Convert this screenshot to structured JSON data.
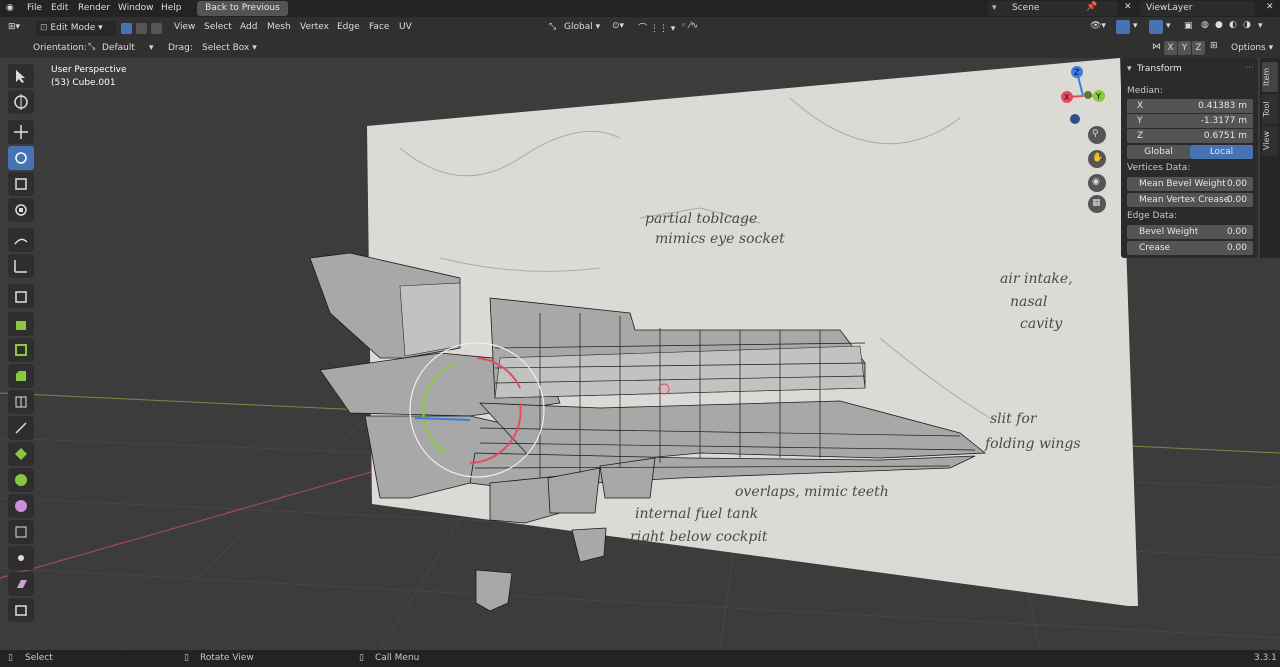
{
  "topbar": {
    "menus": [
      "File",
      "Edit",
      "Render",
      "Window",
      "Help"
    ],
    "back_button": "Back to Previous",
    "scene": "Scene",
    "view_layer": "ViewLayer"
  },
  "header": {
    "mode": "Edit Mode",
    "menus": [
      "View",
      "Select",
      "Add",
      "Mesh",
      "Vertex",
      "Edge",
      "Face",
      "UV"
    ],
    "transform_orientation": "Global"
  },
  "subheader": {
    "orientation_label": "Orientation:",
    "orientation_value": "Default",
    "drag_label": "Drag:",
    "drag_value": "Select Box",
    "axes": [
      "X",
      "Y",
      "Z"
    ],
    "options": "Options"
  },
  "viewport": {
    "perspective": "User Perspective",
    "object": "(53) Cube.001"
  },
  "gizmo": {
    "x": "X",
    "y": "Y",
    "z": "Z"
  },
  "npanel": {
    "title": "Transform",
    "median_label": "Median:",
    "median": [
      {
        "axis": "X",
        "value": "0.41383 m"
      },
      {
        "axis": "Y",
        "value": "-1.3177 m"
      },
      {
        "axis": "Z",
        "value": "0.6751 m"
      }
    ],
    "space_global": "Global",
    "space_local": "Local",
    "vertices_label": "Vertices Data:",
    "mean_bevel_weight_label": "Mean Bevel Weight",
    "mean_bevel_weight": "0.00",
    "mean_vertex_crease_label": "Mean Vertex Crease",
    "mean_vertex_crease": "0.00",
    "edge_label": "Edge Data:",
    "bevel_weight_label": "Bevel Weight",
    "bevel_weight": "0.00",
    "crease_label": "Crease",
    "crease": "0.00"
  },
  "sidetabs": [
    "Item",
    "Tool",
    "View"
  ],
  "statusbar": {
    "select": "Select",
    "rotate": "Rotate View",
    "call_menu": "Call Menu",
    "version": "3.3.1"
  },
  "colors": {
    "accent": "#4772b3",
    "axis_x": "#e84a5f",
    "axis_y": "#8cc63f",
    "axis_z": "#3b7ddd"
  }
}
